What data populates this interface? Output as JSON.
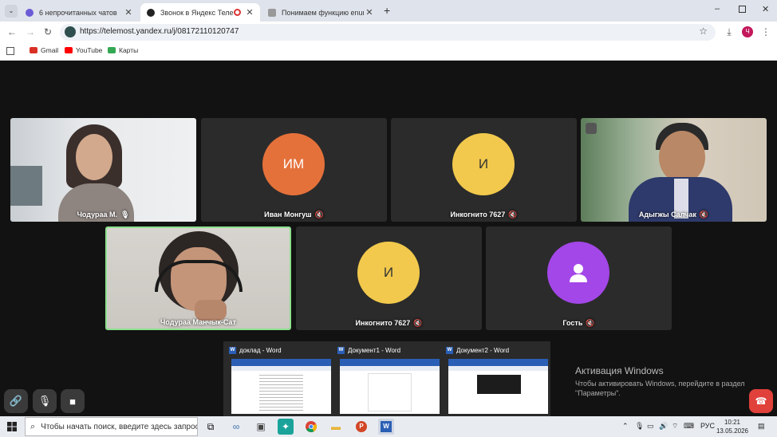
{
  "browser": {
    "tabs": [
      {
        "title": "6 непрочитанных чатов",
        "active": false
      },
      {
        "title": "Звонок в Яндекс Телемост",
        "active": true
      },
      {
        "title": "Понимаем функцию enumerate",
        "active": false
      }
    ],
    "new_tab": "+",
    "url": "https://telemost.yandex.ru/j/08172110120747",
    "profile_initial": "Ч",
    "bookmarks": [
      {
        "label": "Gmail",
        "color": "#d93025"
      },
      {
        "label": "YouTube",
        "color": "#ff0000"
      },
      {
        "label": "Карты",
        "color": "#34a853"
      }
    ]
  },
  "meeting": {
    "participants": [
      {
        "name": "Чодураа М.",
        "type": "video",
        "muted": false
      },
      {
        "name": "Иван Монгуш",
        "type": "avatar",
        "initials": "ИМ",
        "color": "#e5713a",
        "muted": true
      },
      {
        "name": "Инкогнито 7627",
        "type": "avatar",
        "initials": "И",
        "color": "#f2c94c",
        "muted": true
      },
      {
        "name": "Адыгжы Салчак",
        "type": "video",
        "muted": true
      },
      {
        "name": "Чодураа Манчык-Сат",
        "type": "video",
        "muted": false,
        "speaking": true
      },
      {
        "name": "Инкогнито 7627",
        "type": "avatar",
        "initials": "И",
        "color": "#f2c94c",
        "muted": true
      },
      {
        "name": "Гость",
        "type": "avatar",
        "initials": "",
        "color": "#a347e8",
        "muted": true
      }
    ]
  },
  "thumbnails": [
    {
      "title": "доклад - Word"
    },
    {
      "title": "Документ1 - Word"
    },
    {
      "title": "Документ2 - Word"
    }
  ],
  "activation": {
    "title": "Активация Windows",
    "subtitle": "Чтобы активировать Windows, перейдите в раздел \"Параметры\"."
  },
  "taskbar": {
    "search_placeholder": "Чтобы начать поиск, введите здесь запрос",
    "lang": "РУС",
    "time": "10:21",
    "date": "13.05.2026"
  }
}
